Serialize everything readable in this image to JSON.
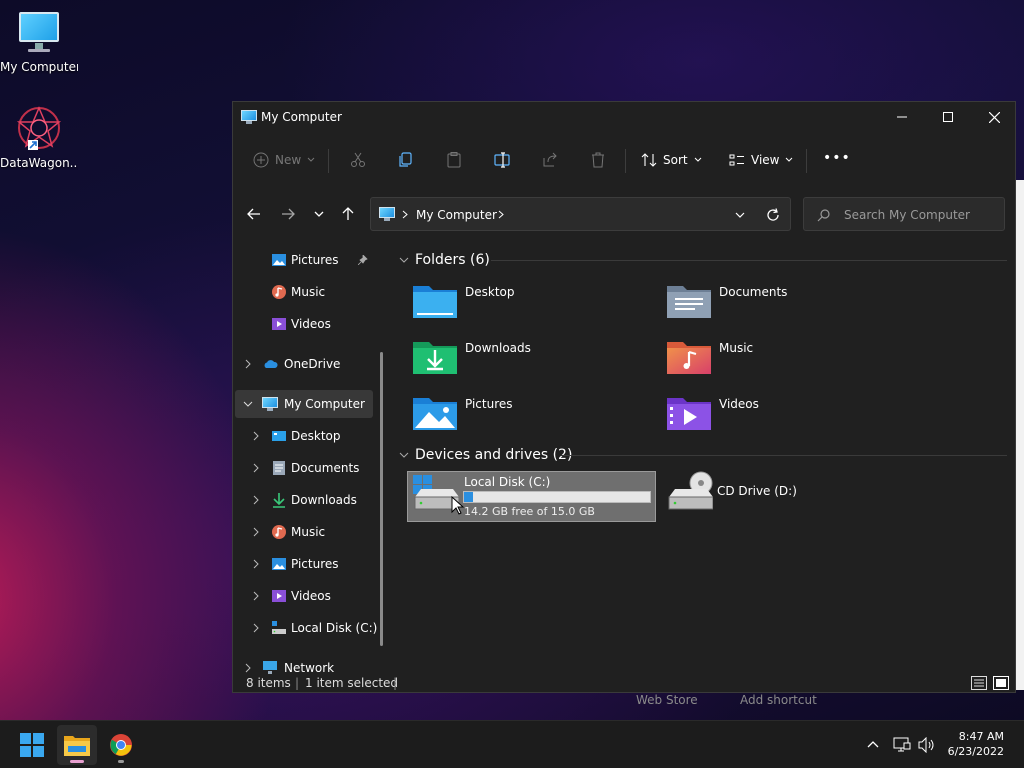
{
  "desktop": {
    "icons": [
      {
        "label": "My Computer"
      },
      {
        "label": "DataWagon..."
      }
    ]
  },
  "window": {
    "title": "My Computer",
    "toolbar": {
      "new_label": "New",
      "sort_label": "Sort",
      "view_label": "View",
      "more_label": "•••"
    },
    "address": {
      "location": "My Computer",
      "search_placeholder": "Search My Computer"
    },
    "sidebar": {
      "items": [
        {
          "label": "Pictures"
        },
        {
          "label": "Music"
        },
        {
          "label": "Videos"
        },
        {
          "label": "OneDrive"
        },
        {
          "label": "My Computer"
        },
        {
          "label": "Desktop"
        },
        {
          "label": "Documents"
        },
        {
          "label": "Downloads"
        },
        {
          "label": "Music"
        },
        {
          "label": "Pictures"
        },
        {
          "label": "Videos"
        },
        {
          "label": "Local Disk (C:)"
        },
        {
          "label": "Network"
        }
      ]
    },
    "content": {
      "folders_header": "Folders (6)",
      "folders": [
        {
          "name": "Desktop"
        },
        {
          "name": "Documents"
        },
        {
          "name": "Downloads"
        },
        {
          "name": "Music"
        },
        {
          "name": "Pictures"
        },
        {
          "name": "Videos"
        }
      ],
      "drives_header": "Devices and drives (2)",
      "drives": [
        {
          "name": "Local Disk (C:)",
          "space": "14.2 GB free of 15.0 GB",
          "used_fraction": 0.05
        },
        {
          "name": "CD Drive (D:)"
        }
      ]
    },
    "status": {
      "items": "8 items",
      "selected": "1 item selected"
    }
  },
  "background_text": {
    "left": "Web Store",
    "right": "Add shortcut"
  },
  "taskbar": {
    "time": "8:47 AM",
    "date": "6/23/2022"
  },
  "colors": {
    "accent": "#2b8fe0",
    "window_bg": "#202020",
    "taskbar_bg": "#1c1c1c"
  }
}
